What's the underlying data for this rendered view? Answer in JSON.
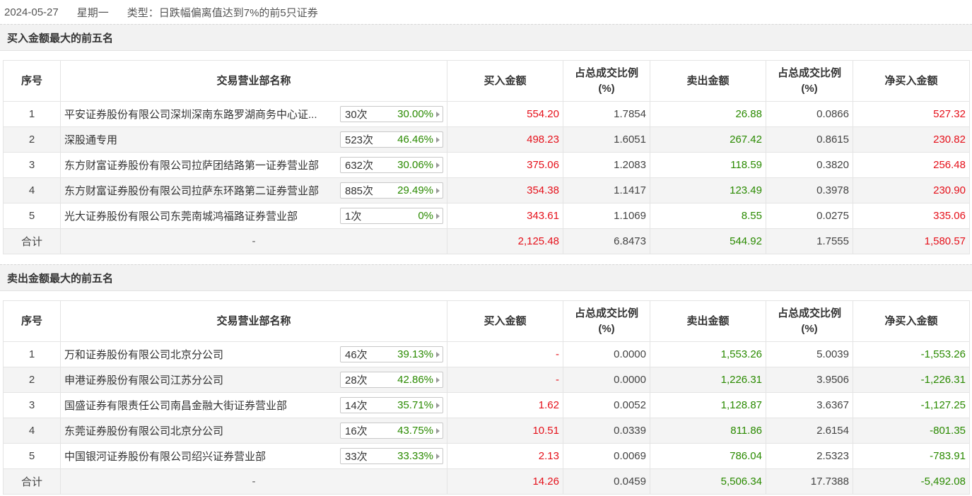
{
  "header": {
    "date": "2024-05-27",
    "weekday": "星期一",
    "type_text": "类型：日跌幅偏离值达到7%的前5只证券"
  },
  "columns": {
    "idx": "序号",
    "name": "交易营业部名称",
    "buy": "买入金额",
    "ratio1_l1": "占总成交比例",
    "ratio1_l2": "(%)",
    "sell": "卖出金额",
    "ratio2_l1": "占总成交比例",
    "ratio2_l2": "(%)",
    "net": "净买入金额"
  },
  "buy_section": {
    "title": "买入金额最大的前五名",
    "rows": [
      {
        "idx": "1",
        "name": "平安证券股份有限公司深圳深南东路罗湖商务中心证...",
        "count": "30次",
        "pct": "30.00%",
        "buy": "554.20",
        "buy_ratio": "1.7854",
        "sell": "26.88",
        "sell_ratio": "0.0866",
        "net": "527.32"
      },
      {
        "idx": "2",
        "name": "深股通专用",
        "count": "523次",
        "pct": "46.46%",
        "buy": "498.23",
        "buy_ratio": "1.6051",
        "sell": "267.42",
        "sell_ratio": "0.8615",
        "net": "230.82"
      },
      {
        "idx": "3",
        "name": "东方财富证券股份有限公司拉萨团结路第一证券营业部",
        "count": "632次",
        "pct": "30.06%",
        "buy": "375.06",
        "buy_ratio": "1.2083",
        "sell": "118.59",
        "sell_ratio": "0.3820",
        "net": "256.48"
      },
      {
        "idx": "4",
        "name": "东方财富证券股份有限公司拉萨东环路第二证券营业部",
        "count": "885次",
        "pct": "29.49%",
        "buy": "354.38",
        "buy_ratio": "1.1417",
        "sell": "123.49",
        "sell_ratio": "0.3978",
        "net": "230.90"
      },
      {
        "idx": "5",
        "name": "光大证券股份有限公司东莞南城鸿福路证券营业部",
        "count": "1次",
        "pct": "0%",
        "buy": "343.61",
        "buy_ratio": "1.1069",
        "sell": "8.55",
        "sell_ratio": "0.0275",
        "net": "335.06"
      }
    ],
    "total": {
      "label": "合计",
      "name": "-",
      "buy": "2,125.48",
      "buy_ratio": "6.8473",
      "sell": "544.92",
      "sell_ratio": "1.7555",
      "net": "1,580.57"
    }
  },
  "sell_section": {
    "title": "卖出金额最大的前五名",
    "rows": [
      {
        "idx": "1",
        "name": "万和证券股份有限公司北京分公司",
        "count": "46次",
        "pct": "39.13%",
        "buy": "-",
        "buy_ratio": "0.0000",
        "sell": "1,553.26",
        "sell_ratio": "5.0039",
        "net": "-1,553.26"
      },
      {
        "idx": "2",
        "name": "申港证券股份有限公司江苏分公司",
        "count": "28次",
        "pct": "42.86%",
        "buy": "-",
        "buy_ratio": "0.0000",
        "sell": "1,226.31",
        "sell_ratio": "3.9506",
        "net": "-1,226.31"
      },
      {
        "idx": "3",
        "name": "国盛证券有限责任公司南昌金融大街证券营业部",
        "count": "14次",
        "pct": "35.71%",
        "buy": "1.62",
        "buy_ratio": "0.0052",
        "sell": "1,128.87",
        "sell_ratio": "3.6367",
        "net": "-1,127.25"
      },
      {
        "idx": "4",
        "name": "东莞证券股份有限公司北京分公司",
        "count": "16次",
        "pct": "43.75%",
        "buy": "10.51",
        "buy_ratio": "0.0339",
        "sell": "811.86",
        "sell_ratio": "2.6154",
        "net": "-801.35"
      },
      {
        "idx": "5",
        "name": "中国银河证券股份有限公司绍兴证券营业部",
        "count": "33次",
        "pct": "33.33%",
        "buy": "2.13",
        "buy_ratio": "0.0069",
        "sell": "786.04",
        "sell_ratio": "2.5323",
        "net": "-783.91"
      }
    ],
    "total": {
      "label": "合计",
      "name": "-",
      "buy": "14.26",
      "buy_ratio": "0.0459",
      "sell": "5,506.34",
      "sell_ratio": "17.7388",
      "net": "-5,492.08"
    }
  },
  "colors": {
    "red": "#e5101a",
    "green": "#2a8a00"
  }
}
